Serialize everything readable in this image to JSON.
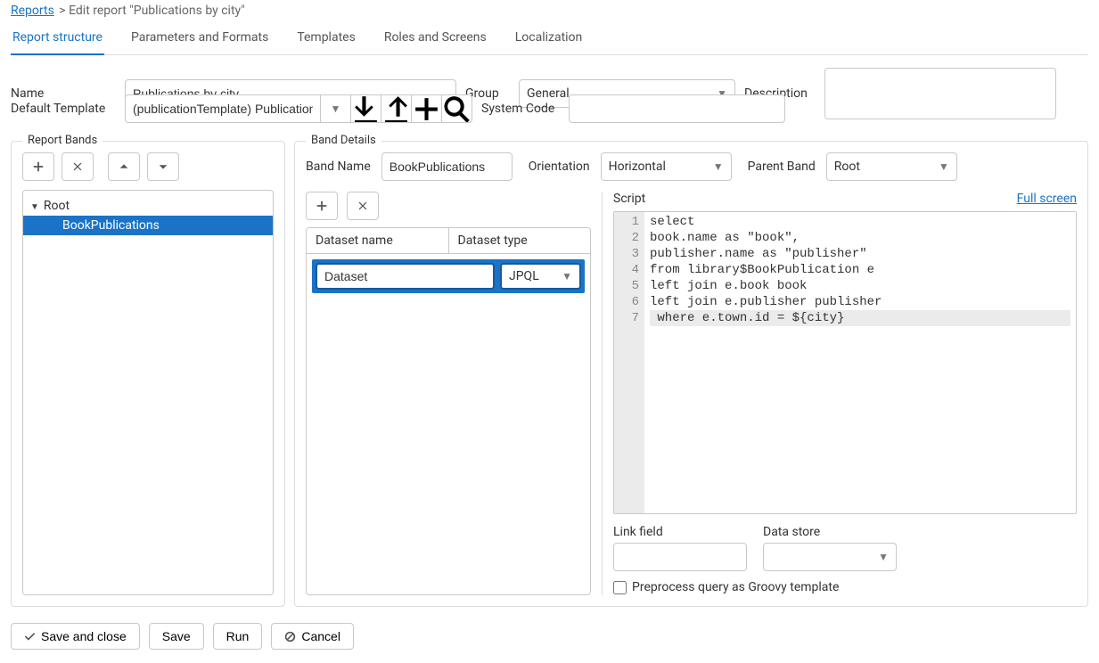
{
  "breadcrumb": {
    "reports_link": "Reports",
    "current": "> Edit report \"Publications by city\""
  },
  "tabs": {
    "structure": "Report structure",
    "params": "Parameters and Formats",
    "templates": "Templates",
    "roles": "Roles and Screens",
    "localization": "Localization"
  },
  "labels": {
    "name": "Name",
    "group": "Group",
    "description": "Description",
    "default_template": "Default Template",
    "system_code": "System Code",
    "report_bands": "Report Bands",
    "band_details": "Band Details",
    "band_name": "Band Name",
    "orientation": "Orientation",
    "parent_band": "Parent Band",
    "dataset_name": "Dataset name",
    "dataset_type": "Dataset type",
    "script": "Script",
    "full_screen": "Full screen",
    "link_field": "Link field",
    "data_store": "Data store",
    "preprocess": "Preprocess query as Groovy template",
    "save_close": "Save and close",
    "save": "Save",
    "run": "Run",
    "cancel": "Cancel"
  },
  "values": {
    "name": "Publications by city",
    "group": "General",
    "default_template": "(publicationTemplate) Publication",
    "system_code": "",
    "description": "",
    "band_name": "BookPublications",
    "orientation": "Horizontal",
    "parent_band": "Root",
    "dataset_name": "Dataset",
    "dataset_type": "JPQL",
    "link_field": "",
    "data_store": "",
    "preprocess_checked": false
  },
  "tree": {
    "root": "Root",
    "child": "BookPublications"
  },
  "script_lines": [
    "select",
    "book.name as \"book\",",
    "publisher.name as \"publisher\"",
    "from library$BookPublication e",
    "left join e.book book",
    "left join e.publisher publisher",
    " where e.town.id = ${city}"
  ]
}
